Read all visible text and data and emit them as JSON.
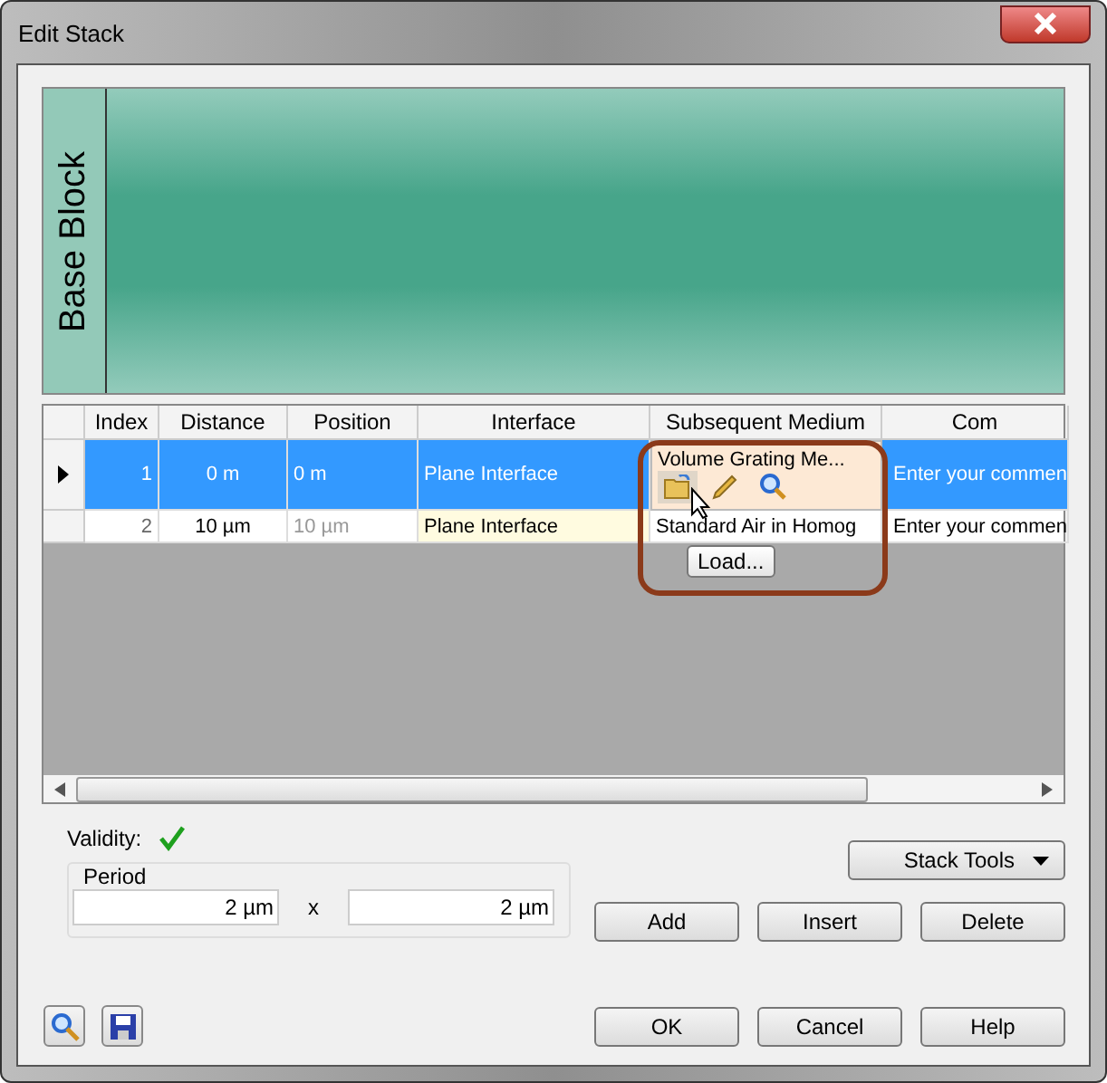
{
  "window": {
    "title": "Edit Stack"
  },
  "base_block": {
    "label": "Base Block"
  },
  "table": {
    "columns": [
      "Index",
      "Distance",
      "Position",
      "Interface",
      "Subsequent Medium",
      "Com"
    ],
    "rows": [
      {
        "selected": true,
        "index": "1",
        "distance": "0 m",
        "position": "0 m",
        "interface": "Plane Interface",
        "medium": "Volume  Grating Me...",
        "comment": "Enter your commen"
      },
      {
        "selected": false,
        "index": "2",
        "distance": "10 µm",
        "position": "10 µm",
        "interface": "Plane Interface",
        "medium": "Standard Air in Homog",
        "comment": "Enter your commen"
      }
    ]
  },
  "tooltip": "Load...",
  "validity": {
    "label": "Validity:",
    "valid": true
  },
  "stack_tools": "Stack Tools",
  "period": {
    "label": "Period",
    "x_value": "2 µm",
    "separator": "x",
    "y_value": "2 µm"
  },
  "row_buttons": [
    "Add",
    "Insert",
    "Delete"
  ],
  "dialog_buttons": [
    "OK",
    "Cancel",
    "Help"
  ]
}
